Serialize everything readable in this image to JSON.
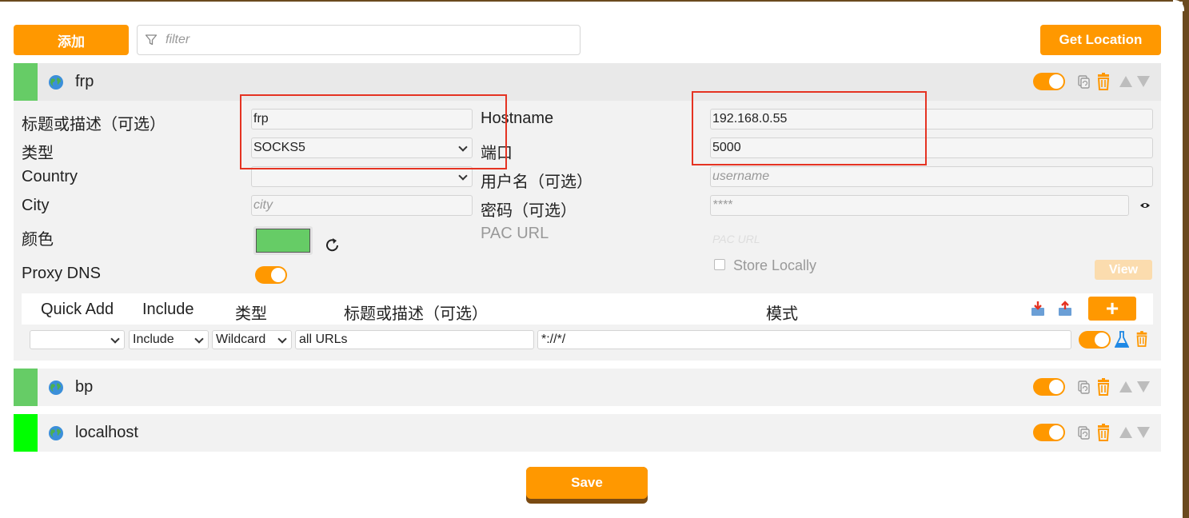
{
  "toolbar": {
    "add_label": "添加",
    "filter_placeholder": "filter",
    "get_location_label": "Get Location"
  },
  "proxies": [
    {
      "name": "frp",
      "bar_color": "#66cc66",
      "enabled": true,
      "expanded": true,
      "form": {
        "title_label": "标题或描述（可选）",
        "title_value": "frp",
        "type_label": "类型",
        "type_value": "SOCKS5",
        "country_label": "Country",
        "country_value": "",
        "city_label": "City",
        "city_placeholder": "city",
        "color_label": "颜色",
        "color_value": "#66cc66",
        "proxy_dns_label": "Proxy DNS",
        "proxy_dns_enabled": true,
        "hostname_label": "Hostname",
        "hostname_value": "192.168.0.55",
        "port_label": "端口",
        "port_value": "5000",
        "username_label": "用户名（可选）",
        "username_placeholder": "username",
        "password_label": "密码（可选）",
        "password_placeholder": "****",
        "pac_url_label": "PAC URL",
        "pac_url_placeholder": "PAC URL",
        "store_locally_label": "Store Locally",
        "store_locally_checked": false,
        "view_label": "View"
      },
      "patterns": {
        "headers": {
          "quick_add": "Quick Add",
          "include": "Include",
          "type": "类型",
          "title": "标题或描述（可选）",
          "pattern": "模式"
        },
        "rows": [
          {
            "quick_add": "",
            "include": "Include",
            "type": "Wildcard",
            "title": "all URLs",
            "pattern": "*://*/",
            "enabled": true
          }
        ]
      }
    },
    {
      "name": "bp",
      "bar_color": "#66cc66",
      "enabled": true,
      "expanded": false
    },
    {
      "name": "localhost",
      "bar_color": "#00ff00",
      "enabled": true,
      "expanded": false
    }
  ],
  "footer": {
    "save_label": "Save"
  },
  "colors": {
    "accent": "#ff9800",
    "highlight_box": "#e53322"
  },
  "icons": [
    "filter-icon",
    "globe-icon",
    "duplicate-icon",
    "trash-icon",
    "move-up-icon",
    "move-down-icon",
    "refresh-icon",
    "eye-icon",
    "import-icon",
    "export-icon",
    "test-flask-icon"
  ]
}
